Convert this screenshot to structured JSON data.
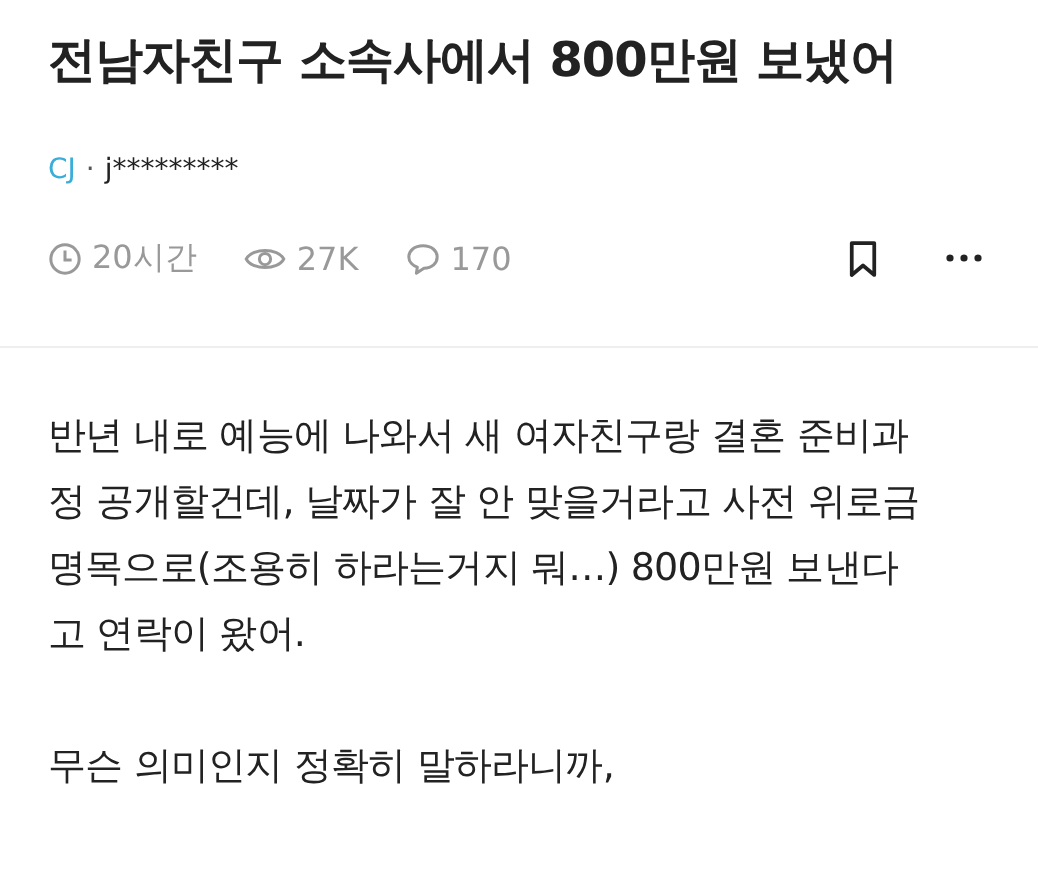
{
  "post": {
    "title": "전남자친구 소속사에서 800만원 보냈어",
    "author": {
      "group": "CJ",
      "separator": "·",
      "user": "j*********"
    },
    "stats": {
      "time": "20시간",
      "views": "27K",
      "comments": "170"
    },
    "bookmarked": false,
    "paragraphs": [
      "반년 내로 예능에 나와서 새 여자친구랑 결혼 준비과\n정 공개할건데, 날짜가 잘 안 맞을거라고 사전 위로금\n명목으로(조용히 하라는거지 뭐…) 800만원 보낸다\n고 연락이 왔어.",
      "무슨 의미인지 정확히 말하라니까,"
    ]
  }
}
